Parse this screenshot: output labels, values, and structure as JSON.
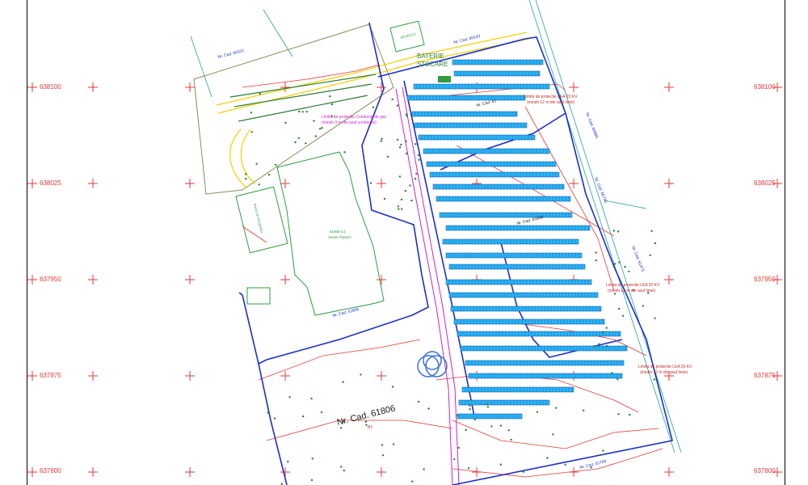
{
  "grid_labels": [
    "638100",
    "638025",
    "637950",
    "637875",
    "637800"
  ],
  "parcels": {
    "main": "Nr. Cad. 61806",
    "n1": "Nr. Cad. 60321",
    "n2": "Nr. Cad. 60143",
    "e1": "Nr. Cad. 60885",
    "e2": "Nr. Cad. 60735",
    "e3": "Nr. Cad. 61473",
    "s1": "Nr. Cad. 61769",
    "mid1": "Nr. Cad. 61806",
    "c1": "Nr. Cad. 61",
    "c2": "Nr. Cad. 61806"
  },
  "labels": {
    "battery_l1": "BATERIE",
    "battery_l2": "STOCARE",
    "building_code": "61806-C1",
    "building_name": "Atelier Piatsch",
    "small_building": "60143-C1",
    "gas_line_1": "Limita de protectie Conducta de gaz",
    "gas_line_2": "(minim 3 m din axul conductei)",
    "lea_a_1": "Limita de protectie LEA 20 KV",
    "lea_a_2": "(minim 12 m din axul liniei)",
    "lea_b_1": "Limita de protectie LEA 20 KV",
    "lea_b_2": "(minim 12 m din axul liniei)",
    "lea_c_1": "Limita de protectie LEA 20 KV",
    "lea_c_2": "(minim 12 m din axul liniei)",
    "annex": "Anexa de inregistrare",
    "plot_mark": "B1"
  },
  "colors": {
    "background": "#ffffff",
    "frame": "#000000",
    "grid_mark": "#e53935",
    "panels": "#29b6f6",
    "parcel_boundary": "#1a2fc9",
    "protection_line": "#e53935",
    "vegetation": "#2e7d32",
    "building": "#2e9e3e",
    "road": "#f5d000",
    "gas_line": "#d020d0",
    "olive_boundary": "#8a8a55"
  }
}
